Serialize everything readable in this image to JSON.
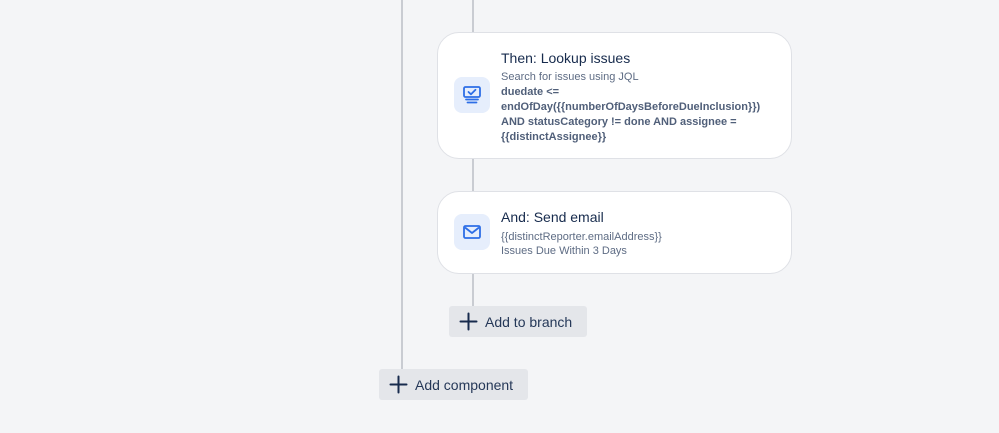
{
  "lookup_card": {
    "title": "Then: Lookup issues",
    "subtitle": "Search for issues using JQL",
    "jql_lines": [
      "duedate <=",
      "endOfDay({{numberOfDaysBeforeDueInclusion}})",
      "AND statusCategory != done AND assignee =",
      "{{distinctAssignee}}"
    ],
    "icon": "monitor-check-icon"
  },
  "email_card": {
    "title": "And: Send email",
    "to": "{{distinctReporter.emailAddress}}",
    "subject": "Issues Due Within 3 Days",
    "icon": "envelope-icon"
  },
  "add_branch_button": {
    "label": "Add to branch",
    "icon": "plus-icon"
  },
  "add_component_button": {
    "label": "Add component",
    "icon": "plus-icon"
  },
  "colors": {
    "background": "#f4f5f7",
    "icon_blue": "#2d6ee6",
    "connector": "#c9ccd2"
  }
}
